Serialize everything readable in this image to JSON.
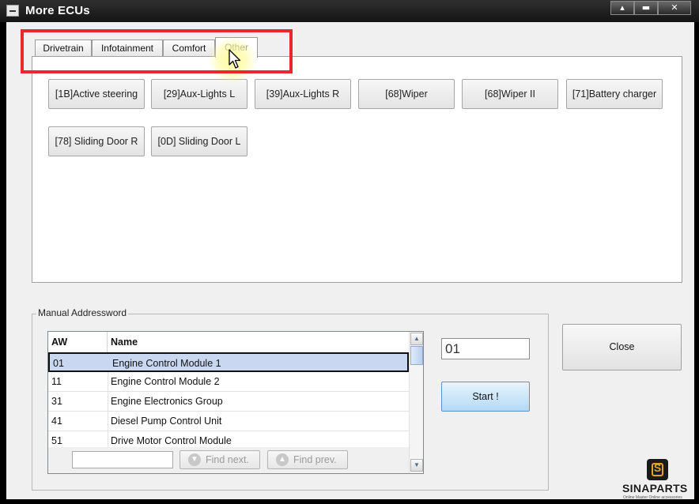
{
  "window": {
    "title": "More ECUs",
    "controls": {
      "minimize": "▴",
      "restore": "▬",
      "close": "✕"
    }
  },
  "tabs": [
    {
      "label": "Drivetrain"
    },
    {
      "label": "Infotainment"
    },
    {
      "label": "Comfort"
    },
    {
      "label": "Other",
      "active": true
    }
  ],
  "ecu_buttons": [
    {
      "label": "[1B]Active steering"
    },
    {
      "label": "[29]Aux-Lights  L"
    },
    {
      "label": "[39]Aux-Lights  R"
    },
    {
      "label": "[68]Wiper"
    },
    {
      "label": "[68]Wiper II"
    },
    {
      "label": "[71]Battery charger"
    },
    {
      "label": "[78] Sliding Door R"
    },
    {
      "label": "[0D] Sliding Door L"
    }
  ],
  "manual": {
    "group_label": "Manual Addressword",
    "columns": {
      "aw": "AW",
      "name": "Name"
    },
    "rows": [
      {
        "aw": "01",
        "name": "Engine Control Module 1",
        "selected": true
      },
      {
        "aw": "11",
        "name": "Engine Control Module 2"
      },
      {
        "aw": "31",
        "name": "Engine Electronics Group"
      },
      {
        "aw": "41",
        "name": "Diesel Pump Control Unit"
      },
      {
        "aw": "51",
        "name": "Drive Motor Control Module"
      }
    ],
    "find_input_value": "",
    "find_next_label": "Find next.",
    "find_prev_label": "Find prev.",
    "aw_value": "01",
    "start_label": "Start !"
  },
  "close_label": "Close",
  "watermark": {
    "badge": "S",
    "text": "SINAPARTS",
    "sub": "Online Master  Online accessories"
  },
  "colors": {
    "highlight": "#e8282a",
    "selected_row": "#c9d8f0",
    "start_button": "#b2daf6",
    "logo_accent": "#e3a12a"
  }
}
